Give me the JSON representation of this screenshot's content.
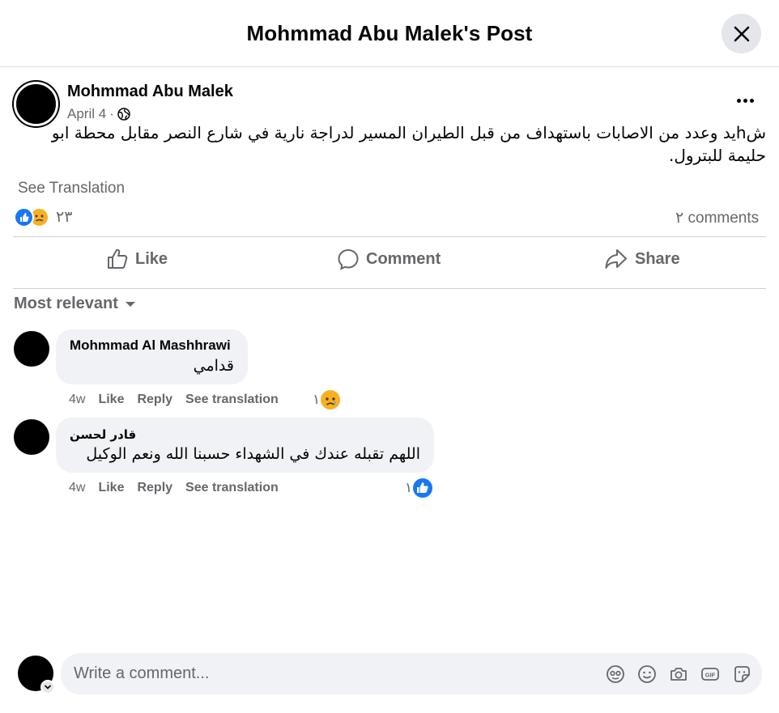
{
  "header": {
    "title": "Mohmmad Abu Malek's Post",
    "close_icon": "close-icon"
  },
  "post": {
    "author": "Mohmmad Abu Malek",
    "date": "April 4",
    "separator": "·",
    "audience_icon": "globe-icon",
    "text": "شhيد وعدد من الاصابات باستهداف من قبل الطيران المسير لدراجة نارية في شارع النصر مقابل محطة ابو حليمة للبترول.",
    "see_translation": "See Translation",
    "reaction_count": "٢٣",
    "comment_count": "٢ comments"
  },
  "actions": {
    "like": "Like",
    "comment": "Comment",
    "share": "Share"
  },
  "sort": {
    "label": "Most relevant"
  },
  "comments": [
    {
      "author": "Mohmmad Al Mashhrawi",
      "text": "قدامي",
      "time": "4w",
      "like": "Like",
      "reply": "Reply",
      "see_translation": "See translation",
      "reaction_count": "١",
      "reaction_icon": "sad-emoji-icon"
    },
    {
      "author": "قادر لحسن",
      "text": "اللهم تقبله عندك في الشهداء حسبنا الله ونعم الوكيل",
      "time": "4w",
      "like": "Like",
      "reply": "Reply",
      "see_translation": "See translation",
      "reaction_count": "١",
      "reaction_icon": "like-icon"
    }
  ],
  "composer": {
    "placeholder": "Write a comment...",
    "icons": [
      "avatar-sticker-icon",
      "emoji-icon",
      "camera-icon",
      "gif-icon",
      "sticker-icon"
    ]
  },
  "colors": {
    "accent": "#1877f2",
    "muted": "#65676b",
    "bubble": "#f0f2f5",
    "sad": "#f7b125"
  }
}
